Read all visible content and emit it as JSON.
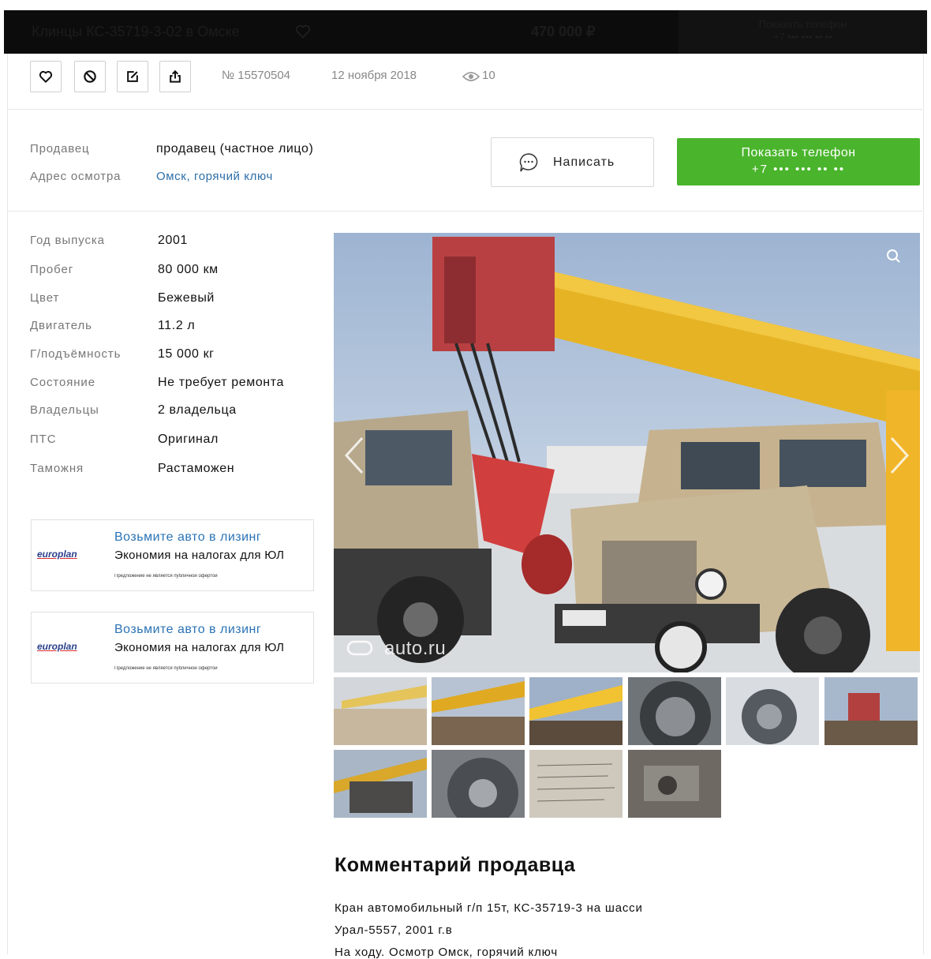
{
  "sticky_header": {
    "title": "Клинцы КС-35719-3-02 в Омске",
    "price": "470 000 ₽",
    "phone_label": "Показать телефон",
    "phone_masked": "+7 ••• ••• •• ••"
  },
  "listing": {
    "number": "№ 15570504",
    "date": "12 ноября 2018",
    "views": "10"
  },
  "seller": {
    "seller_label": "Продавец",
    "seller_value": "продавец (частное лицо)",
    "address_label": "Адрес осмотра",
    "address_value": "Омск, горячий ключ",
    "write_label": "Написать",
    "phone_label": "Показать телефон",
    "phone_masked": "+7 ••• ••• •• ••"
  },
  "specs": [
    {
      "label": "Год выпуска",
      "value": "2001"
    },
    {
      "label": "Пробег",
      "value": "80 000 км"
    },
    {
      "label": "Цвет",
      "value": "Бежевый"
    },
    {
      "label": "Двигатель",
      "value": "11.2 л"
    },
    {
      "label": "Г/подъёмность",
      "value": "15 000 кг"
    },
    {
      "label": "Состояние",
      "value": "Не требует ремонта"
    },
    {
      "label": "Владельцы",
      "value": "2 владельца"
    },
    {
      "label": "ПТС",
      "value": "Оригинал"
    },
    {
      "label": "Таможня",
      "value": "Растаможен"
    }
  ],
  "ads": [
    {
      "logo": "europlan",
      "title": "Возьмите авто в лизинг",
      "subtitle": "Экономия на налогах для ЮЛ",
      "disclaimer": "Предложение не является публичной офертой"
    },
    {
      "logo": "europlan",
      "title": "Возьмите авто в лизинг",
      "subtitle": "Экономия на налогах для ЮЛ",
      "disclaimer": "Предложение не является публичной офертой"
    }
  ],
  "gallery": {
    "watermark": "auto.ru",
    "thumb_count": 10
  },
  "comment": {
    "title": "Комментарий продавца",
    "lines": [
      "Кран автомобильный г/п 15т, КС-35719-3 на шасси",
      "Урал-5557, 2001 г.в",
      "На ходу. Осмотр Омск, горячий ключ"
    ]
  },
  "colors": {
    "accent_green": "#4ab52c",
    "link_blue": "#2c6ea8"
  }
}
